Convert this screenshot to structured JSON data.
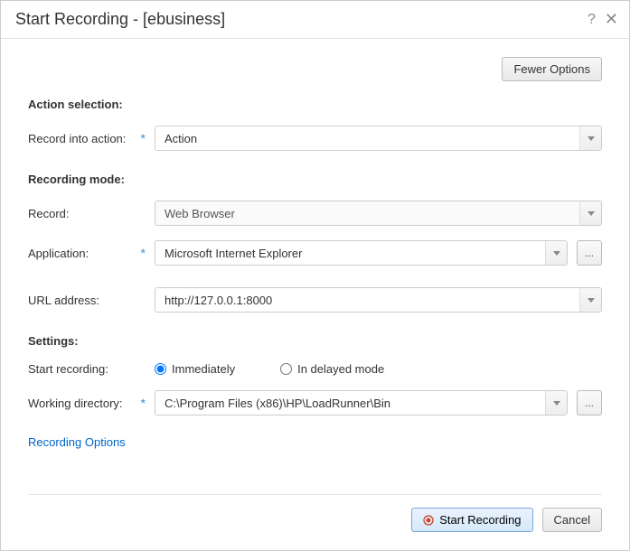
{
  "titlebar": {
    "title": "Start Recording - [ebusiness]"
  },
  "toolbar": {
    "fewer_options_label": "Fewer Options"
  },
  "sections": {
    "action_selection": {
      "header": "Action selection:",
      "record_into_action_label": "Record into action:",
      "record_into_action_value": "Action"
    },
    "recording_mode": {
      "header": "Recording mode:",
      "record_label": "Record:",
      "record_value": "Web Browser",
      "application_label": "Application:",
      "application_value": "Microsoft Internet Explorer",
      "url_label": "URL address:",
      "url_value": "http://127.0.0.1:8000"
    },
    "settings": {
      "header": "Settings:",
      "start_recording_label": "Start recording:",
      "immediately_label": "Immediately",
      "delayed_label": "In delayed mode",
      "working_dir_label": "Working directory:",
      "working_dir_value": "C:\\Program Files (x86)\\HP\\LoadRunner\\Bin"
    }
  },
  "links": {
    "recording_options": "Recording Options"
  },
  "buttons": {
    "start_recording": "Start Recording",
    "cancel": "Cancel",
    "browse": "..."
  }
}
